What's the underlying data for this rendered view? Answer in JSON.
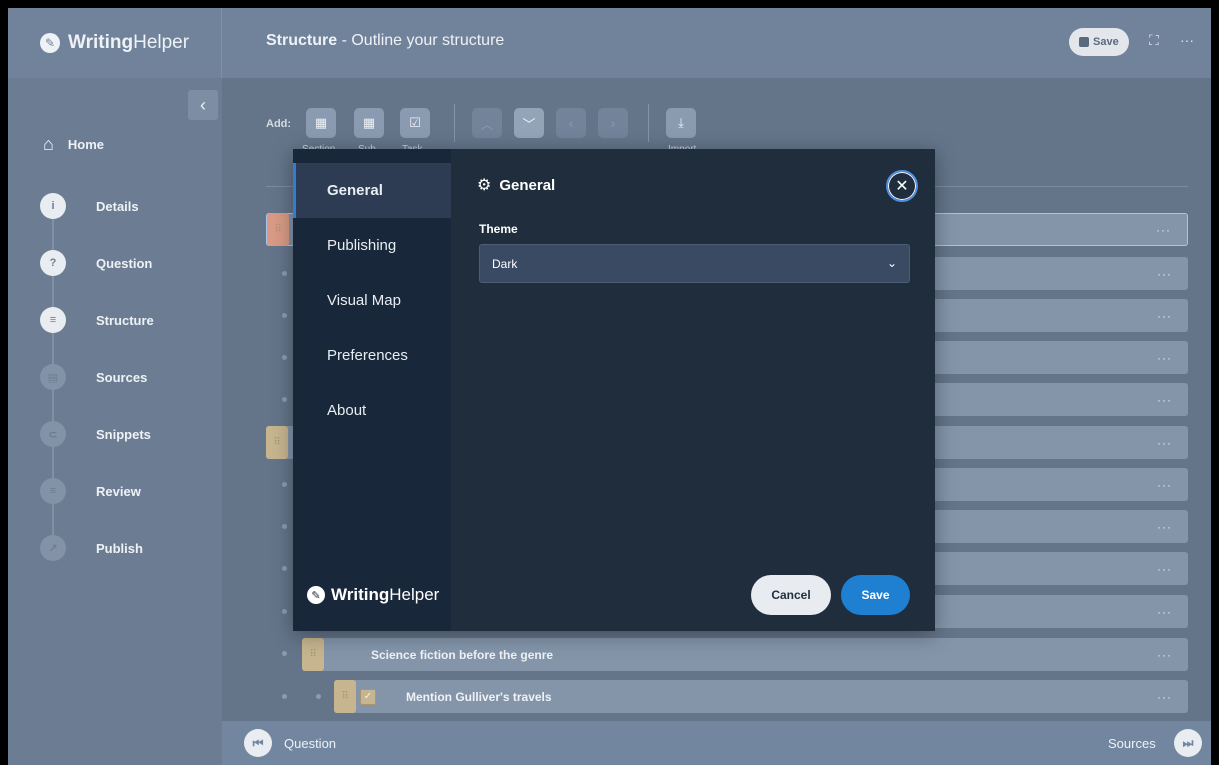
{
  "brand": {
    "name_bold": "Writing",
    "name_light": "Helper"
  },
  "header": {
    "title_bold": "Structure",
    "title_rest": " - Outline your structure",
    "save_label": "Save",
    "fullscreen_icon": "expand-icon",
    "more_icon": "more-icon"
  },
  "sidebar": {
    "home_label": "Home",
    "steps": [
      {
        "label": "Details",
        "icon": "info-icon"
      },
      {
        "label": "Question",
        "icon": "question-icon"
      },
      {
        "label": "Structure",
        "icon": "structure-icon"
      },
      {
        "label": "Sources",
        "icon": "sources-icon"
      },
      {
        "label": "Snippets",
        "icon": "snippets-icon"
      },
      {
        "label": "Review",
        "icon": "review-icon"
      },
      {
        "label": "Publish",
        "icon": "publish-icon"
      }
    ]
  },
  "toolbar": {
    "add_label": "Add:",
    "captions": [
      "Section",
      "Sub",
      "Task",
      "Import"
    ]
  },
  "outline": {
    "rows": [
      {
        "label": "Science fiction before the genre"
      },
      {
        "label": "Mention Gulliver's travels"
      }
    ]
  },
  "bottom": {
    "prev_label": "Question",
    "next_label": "Sources"
  },
  "modal": {
    "tabs": [
      "General",
      "Publishing",
      "Visual Map",
      "Preferences",
      "About"
    ],
    "active_tab": "General",
    "heading": "General",
    "theme_label": "Theme",
    "theme_value": "Dark",
    "cancel_label": "Cancel",
    "save_label": "Save",
    "close_icon": "close-icon"
  },
  "colors": {
    "accent": "#1f7fd0",
    "modal_bg": "#1f2d3d",
    "modal_side": "#19273a",
    "overlay": "#66768a"
  }
}
